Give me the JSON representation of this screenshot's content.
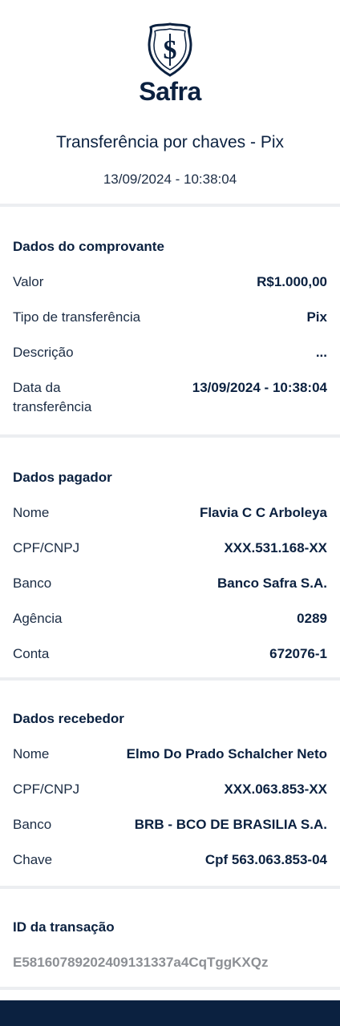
{
  "brand": {
    "name": "Safra"
  },
  "receipt": {
    "title": "Transferência por chaves - Pix",
    "datetime": "13/09/2024 - 10:38:04"
  },
  "comprovante": {
    "title": "Dados do comprovante",
    "rows": [
      {
        "label": "Valor",
        "value": "R$1.000,00"
      },
      {
        "label": "Tipo de transferência",
        "value": "Pix"
      },
      {
        "label": "Descrição",
        "value": "..."
      },
      {
        "label": "Data da transferência",
        "value": "13/09/2024 - 10:38:04"
      }
    ]
  },
  "pagador": {
    "title": "Dados pagador",
    "rows": [
      {
        "label": "Nome",
        "value": "Flavia C C Arboleya"
      },
      {
        "label": "CPF/CNPJ",
        "value": "XXX.531.168-XX"
      },
      {
        "label": "Banco",
        "value": "Banco Safra S.A."
      },
      {
        "label": "Agência",
        "value": "0289"
      },
      {
        "label": "Conta",
        "value": "672076-1"
      }
    ]
  },
  "recebedor": {
    "title": "Dados recebedor",
    "rows": [
      {
        "label": "Nome",
        "value": "Elmo Do Prado Schalcher Neto"
      },
      {
        "label": "CPF/CNPJ",
        "value": "XXX.063.853-XX"
      },
      {
        "label": "Banco",
        "value": "BRB - BCO DE BRASILIA S.A."
      },
      {
        "label": "Chave",
        "value": "Cpf 563.063.853-04"
      }
    ]
  },
  "transacao": {
    "title": "ID da transação",
    "id": "E58160789202409131337a4CqTggKXQz"
  },
  "colors": {
    "primary": "#0b2140",
    "muted": "#8c8f94",
    "divider": "#eceef1"
  },
  "icons": {
    "logo": "safra-crest-icon"
  }
}
